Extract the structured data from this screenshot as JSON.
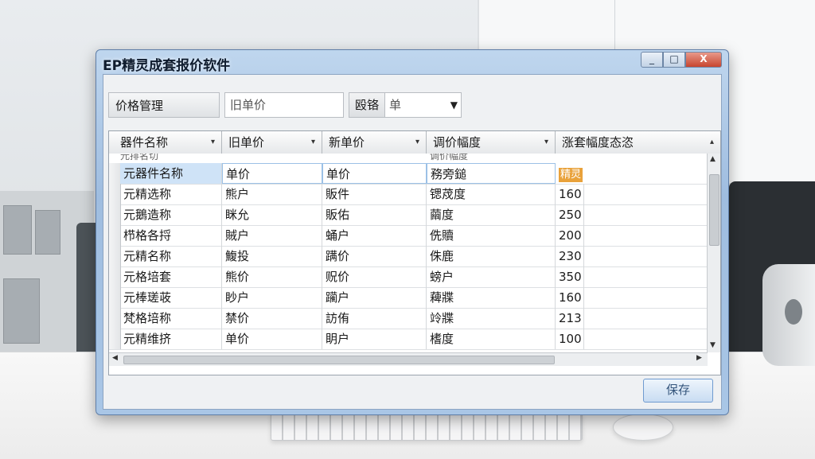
{
  "window": {
    "title": "EP精灵成套报价软件",
    "controls": {
      "minimize": "_",
      "maximize": "□",
      "close": "X"
    }
  },
  "toolbar": {
    "label": "价格管理",
    "input_value": "旧单价",
    "combo_label": "殴铬",
    "combo_value": "单"
  },
  "grid": {
    "columns": [
      {
        "label": "器件名称",
        "sort": "▾"
      },
      {
        "label": "旧单价",
        "sort": "▾"
      },
      {
        "label": "新单价",
        "sort": "▾"
      },
      {
        "label": "调价幅度",
        "sort": "▾"
      },
      {
        "label": "涨套幅度态恣",
        "sort": "▴"
      }
    ],
    "ghost_row": [
      "元排名切",
      "",
      "",
      "调价幅度",
      ""
    ],
    "rows": [
      [
        "元器件名称",
        "单价",
        "单价",
        "務旁鎚",
        "精灵"
      ],
      [
        "元精选称",
        "熊户",
        "販件",
        "锶荗度",
        "160"
      ],
      [
        "元鵝造称",
        "眯允",
        "販佑",
        "繭度",
        "250"
      ],
      [
        "栉格各捋",
        "賊户",
        "蛹户",
        "侁贖",
        "200"
      ],
      [
        "元精名称",
        "鰒投",
        "蹒价",
        "侏鹿",
        "230"
      ],
      [
        "元格培套",
        "熊价",
        "贶价",
        "螃户",
        "350"
      ],
      [
        "元棒瑳荍",
        "眇户",
        "躏户",
        "薭牃",
        "160"
      ],
      [
        "梵格培称",
        "禁价",
        "訪侑",
        "竛牃",
        "213"
      ],
      [
        "元精维挤",
        "单价",
        "眀户",
        "榰度",
        "100"
      ]
    ],
    "accent_tag_color": "#e9a23b",
    "selected_row_color": "#cfe3f7"
  },
  "save_label": "保存"
}
